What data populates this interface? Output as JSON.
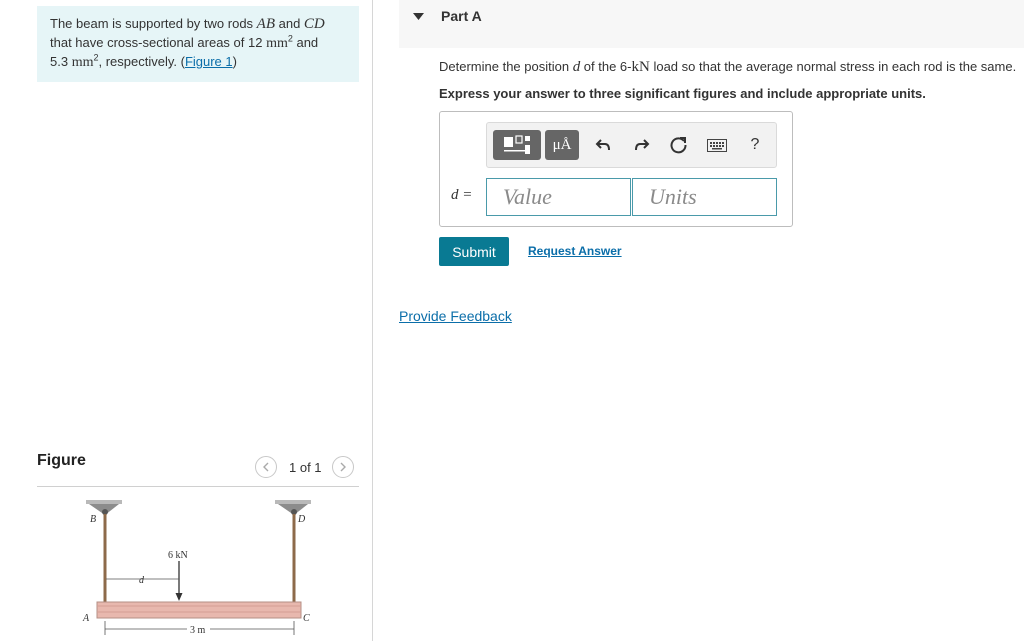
{
  "problem": {
    "text_before_ab": "The beam is supported by two rods ",
    "rod_ab": "AB",
    "text_and": " and ",
    "rod_cd": "CD",
    "text_areas_prefix": "that have cross-sectional areas of 12 ",
    "unit_mm": "mm",
    "sup_2": "2",
    "text_and2": " and",
    "area2_value": "5.3 ",
    "text_respectively": ", respectively. (",
    "figure_link": "Figure 1",
    "close_paren": ")"
  },
  "figure_panel": {
    "heading": "Figure",
    "counter": "1 of 1",
    "prev_icon": "chevron-left-icon",
    "next_icon": "chevron-right-icon",
    "labels": {
      "B": "B",
      "D": "D",
      "A": "A",
      "C": "C",
      "load": "6 kN",
      "d": "d",
      "span": "3 m"
    }
  },
  "part": {
    "caret_icon": "caret-down-icon",
    "title": "Part A"
  },
  "question": {
    "prefix": "Determine the position ",
    "var_d": "d",
    "mid": " of the 6-",
    "unit_kn": "kN",
    "suffix": " load so that the average normal stress in each rod is the same."
  },
  "instruction": "Express your answer to three significant figures and include appropriate units.",
  "toolbar": {
    "templates_icon": "templates-icon",
    "mu_angstrom_label": "μÅ",
    "undo_icon": "undo-icon",
    "redo_icon": "redo-icon",
    "reset_icon": "reset-icon",
    "keyboard_icon": "keyboard-icon",
    "help_label": "?"
  },
  "answer": {
    "variable_label": "d =",
    "value_placeholder": "Value",
    "units_placeholder": "Units"
  },
  "actions": {
    "submit_label": "Submit",
    "request_answer_label": "Request Answer",
    "feedback_label": "Provide Feedback"
  },
  "colors": {
    "problem_bg": "#e6f5f7",
    "submit_bg": "#097a93",
    "link": "#0b6ea9",
    "field_border": "#4a9aaa"
  }
}
